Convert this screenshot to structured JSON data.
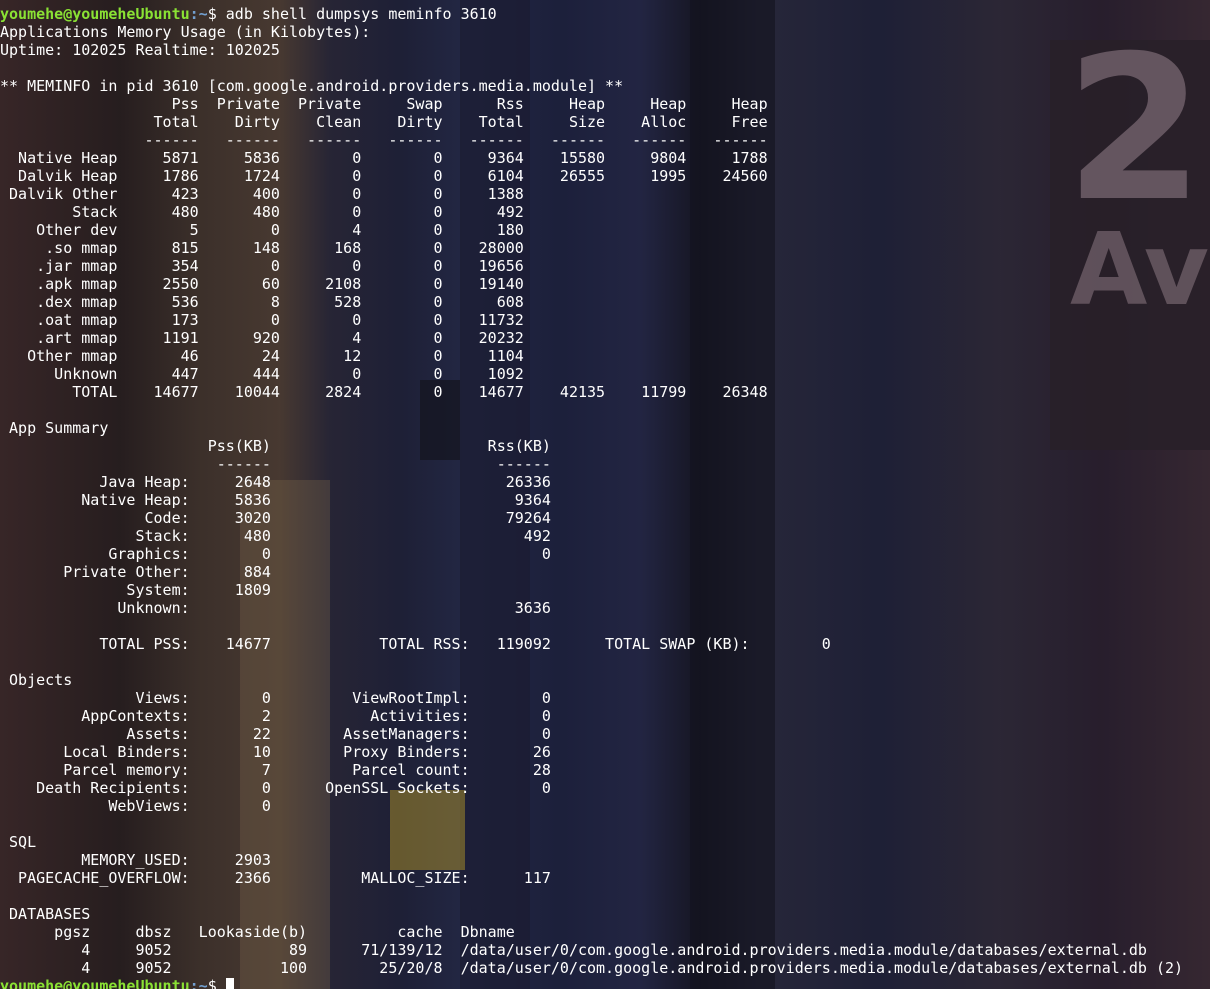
{
  "prompt": {
    "user_host": "youmehe@youmeheUbuntu",
    "path": ":~",
    "symbol": "$ ",
    "command": "adb shell dumpsys meminfo 3610"
  },
  "output_lines": [
    "Applications Memory Usage (in Kilobytes):",
    "Uptime: 102025 Realtime: 102025",
    "",
    "** MEMINFO in pid 3610 [com.google.android.providers.media.module] **",
    "                   Pss  Private  Private     Swap      Rss     Heap     Heap     Heap",
    "                 Total    Dirty    Clean    Dirty    Total     Size    Alloc     Free",
    "                ------   ------   ------   ------   ------   ------   ------   ------",
    "  Native Heap     5871     5836        0        0     9364    15580     9804     1788",
    "  Dalvik Heap     1786     1724        0        0     6104    26555     1995    24560",
    " Dalvik Other      423      400        0        0     1388",
    "        Stack      480      480        0        0      492",
    "    Other dev        5        0        4        0      180",
    "     .so mmap      815      148      168        0    28000",
    "    .jar mmap      354        0        0        0    19656",
    "    .apk mmap     2550       60     2108        0    19140",
    "    .dex mmap      536        8      528        0      608",
    "    .oat mmap      173        0        0        0    11732",
    "    .art mmap     1191      920        4        0    20232",
    "   Other mmap       46       24       12        0     1104",
    "      Unknown      447      444        0        0     1092",
    "        TOTAL    14677    10044     2824        0    14677    42135    11799    26348",
    "",
    " App Summary",
    "                       Pss(KB)                        Rss(KB)",
    "                        ------                         ------",
    "           Java Heap:     2648                          26336",
    "         Native Heap:     5836                           9364",
    "                Code:     3020                          79264",
    "               Stack:      480                            492",
    "            Graphics:        0                              0",
    "       Private Other:      884",
    "              System:     1809",
    "             Unknown:                                    3636",
    "",
    "           TOTAL PSS:    14677            TOTAL RSS:   119092      TOTAL SWAP (KB):        0",
    "",
    " Objects",
    "               Views:        0         ViewRootImpl:        0",
    "         AppContexts:        2           Activities:        0",
    "              Assets:       22        AssetManagers:        0",
    "       Local Binders:       10        Proxy Binders:       26",
    "       Parcel memory:        7         Parcel count:       28",
    "    Death Recipients:        0      OpenSSL Sockets:        0",
    "            WebViews:        0",
    "",
    " SQL",
    "         MEMORY_USED:     2903",
    "  PAGECACHE_OVERFLOW:     2366          MALLOC_SIZE:      117",
    "",
    " DATABASES",
    "      pgsz     dbsz   Lookaside(b)          cache  Dbname",
    "         4     9052             89      71/139/12  /data/user/0/com.google.android.providers.media.module/databases/external.db",
    "         4     9052            100        25/20/8  /data/user/0/com.google.android.providers.media.module/databases/external.db (2)"
  ],
  "final_prompt": {
    "user_host": "youmehe@youmeheUbuntu",
    "path": ":~",
    "symbol": "$ "
  },
  "wallpaper_text": {
    "number": "2",
    "letters": "Av"
  },
  "colors": {
    "prompt_user": "#8ae234",
    "prompt_path": "#729fcf",
    "text": "#ffffff"
  }
}
